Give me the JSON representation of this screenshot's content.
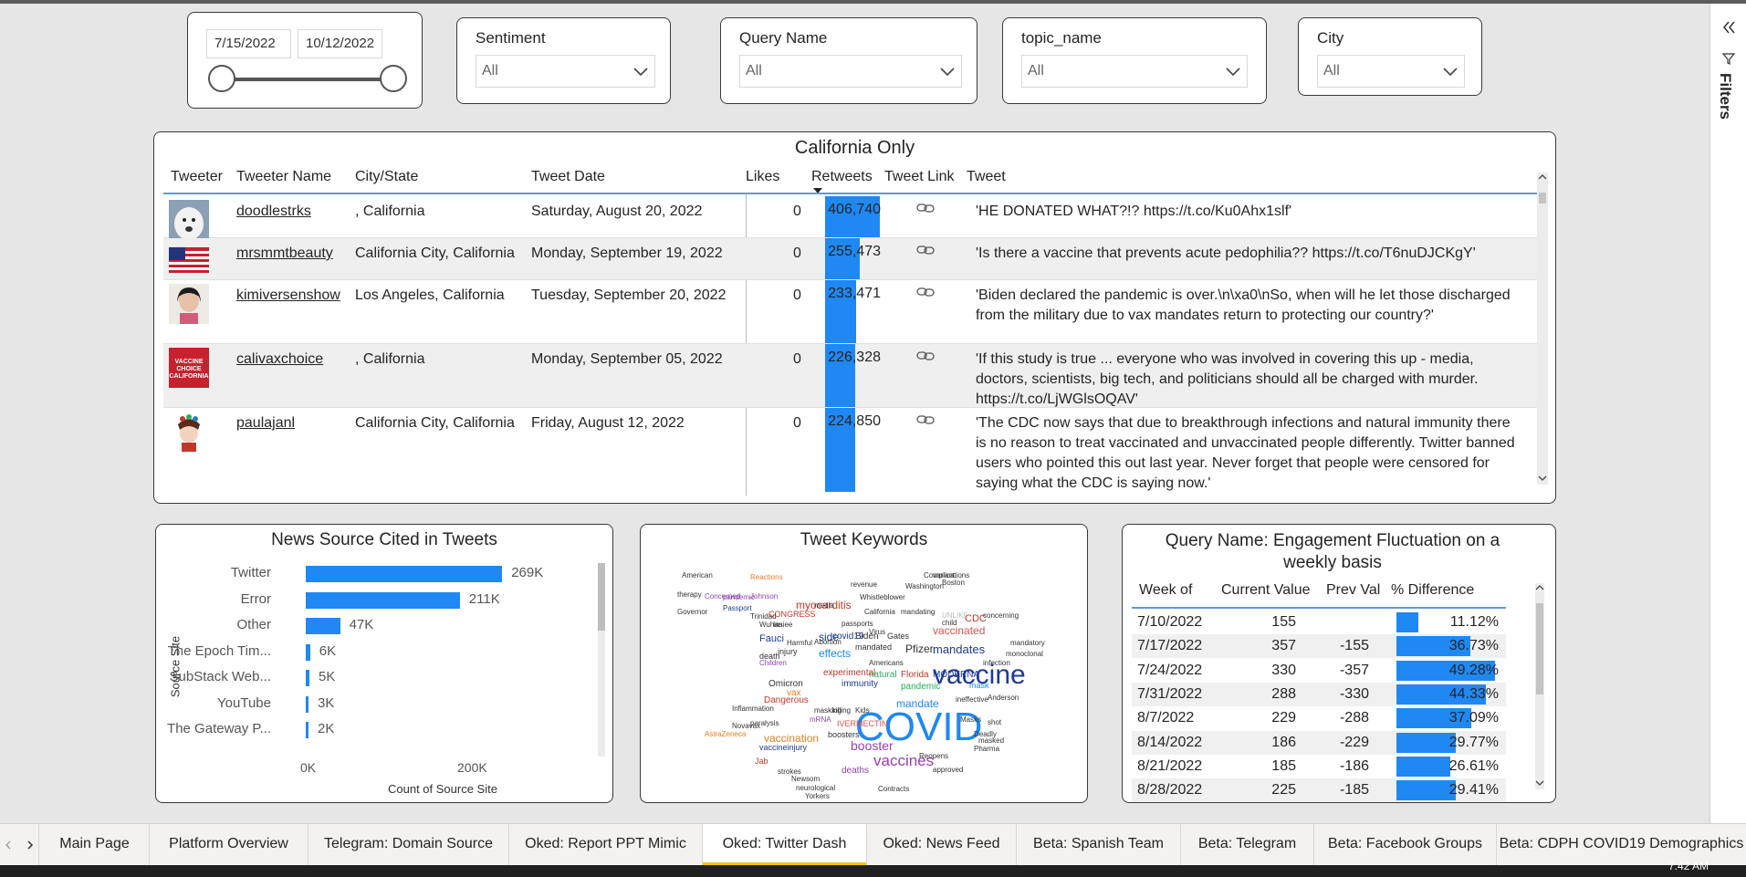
{
  "slicers": {
    "date": {
      "start": "7/15/2022",
      "end": "10/12/2022"
    },
    "dropdowns": [
      {
        "label": "Sentiment",
        "value": "All"
      },
      {
        "label": "Query Name",
        "value": "All"
      },
      {
        "label": "topic_name",
        "value": "All"
      },
      {
        "label": "City",
        "value": "All"
      }
    ]
  },
  "filters_pane": {
    "label": "Filters",
    "icons": [
      "double-chevron-left-icon",
      "funnel-icon"
    ]
  },
  "table": {
    "title": "California Only",
    "headers": [
      "Tweeter",
      "Tweeter Name",
      "City/State",
      "Tweet Date",
      "Likes",
      "Retweets",
      "Tweet Link",
      "Tweet"
    ],
    "rows": [
      {
        "name": "doodlestrks",
        "city": ", California",
        "date": "Saturday, August 20, 2022",
        "likes": "0",
        "retweets": "406,740",
        "retweets_value": 406740,
        "tweet": "'HE DONATED WHAT?!? https://t.co/Ku0Ahx1slf'"
      },
      {
        "name": "mrsmmtbeauty",
        "city": "California City, California",
        "date": "Monday, September 19, 2022",
        "likes": "0",
        "retweets": "255,473",
        "retweets_value": 255473,
        "tweet": "'Is there a vaccine that prevents acute pedophilia?? https://t.co/T6nuDJCKgY'"
      },
      {
        "name": "kimiversenshow",
        "city": "Los Angeles, California",
        "date": "Tuesday, September 20, 2022",
        "likes": "0",
        "retweets": "233,471",
        "retweets_value": 233471,
        "tweet": "'Biden declared the pandemic is over.\\n\\xa0\\nSo, when will he let those discharged from the military due to vax mandates return to protecting our country?'"
      },
      {
        "name": "calivaxchoice",
        "city": ", California",
        "date": "Monday, September 05, 2022",
        "likes": "0",
        "retweets": "226,328",
        "retweets_value": 226328,
        "tweet": "'If this study is true ... everyone who was involved in covering this up - media, doctors, scientists, big tech, and politicians should all be charged with murder. https://t.co/LjWGlsOQAV'"
      },
      {
        "name": "paulajanl",
        "city": "California City, California",
        "date": "Friday, August 12, 2022",
        "likes": "0",
        "retweets": "224,850",
        "retweets_value": 224850,
        "tweet": "'The CDC now says that due to breakthrough infections and natural immunity there is no reason to treat vaccinated and unvaccinated people differently. Twitter banned users who pointed this out last year. Never forget that people were censored for saying what the CDC is saying now.'"
      }
    ],
    "avatar_text": "VACCINE CHOICE CALIFORNIA"
  },
  "news_chart": {
    "title": "News Source Cited in Tweets",
    "ylabel": "Source Site",
    "xlabel": "Count of Source Site",
    "xticks": [
      "0K",
      "200K"
    ]
  },
  "chart_data": {
    "type": "bar",
    "orientation": "horizontal",
    "title": "News Source Cited in Tweets",
    "xlabel": "Count of Source Site",
    "ylabel": "Source Site",
    "categories": [
      "Twitter",
      "Error",
      "Other",
      "The Epoch Tim...",
      "SubStack Web...",
      "YouTube",
      "The Gateway P..."
    ],
    "values": [
      269000,
      211000,
      47000,
      6000,
      5000,
      3000,
      2000
    ],
    "labels": [
      "269K",
      "211K",
      "47K",
      "6K",
      "5K",
      "3K",
      "2K"
    ],
    "xlim": [
      0,
      300000
    ]
  },
  "wordcloud": {
    "title": "Tweet Keywords",
    "words": [
      {
        "text": "COVID",
        "size": 44,
        "color": "#1f88f3"
      },
      {
        "text": "vaccine",
        "size": 30,
        "color": "#1f3a93"
      },
      {
        "text": "vaccines",
        "size": 17,
        "color": "#9b3fb5"
      },
      {
        "text": "booster",
        "size": 14,
        "color": "#9b3fb5"
      },
      {
        "text": "mandates",
        "size": 13,
        "color": "#1f3a93"
      },
      {
        "text": "vaccinated",
        "size": 12,
        "color": "#d9534f"
      },
      {
        "text": "myocarditis",
        "size": 12,
        "color": "#c0392b"
      },
      {
        "text": "Pfizer",
        "size": 12,
        "color": "#333333"
      },
      {
        "text": "mandate",
        "size": 12,
        "color": "#1f88f3"
      },
      {
        "text": "effects",
        "size": 12,
        "color": "#1f88f3"
      },
      {
        "text": "vaccination",
        "size": 12,
        "color": "#e67e22"
      },
      {
        "text": "side",
        "size": 12,
        "color": "#1f3a93"
      },
      {
        "text": "Fauci",
        "size": 11,
        "color": "#1f3a93"
      },
      {
        "text": "CDC",
        "size": 11,
        "color": "#c0392b"
      },
      {
        "text": "MODERNA",
        "size": 10,
        "color": "#1f3a93"
      },
      {
        "text": "pandemic",
        "size": 10,
        "color": "#27ae60"
      },
      {
        "text": "Florida",
        "size": 10,
        "color": "#c0392b"
      },
      {
        "text": "immunity",
        "size": 10,
        "color": "#1f3a93"
      },
      {
        "text": "Omicron",
        "size": 10,
        "color": "#333333"
      },
      {
        "text": "natural",
        "size": 10,
        "color": "#27ae60"
      },
      {
        "text": "deaths",
        "size": 10,
        "color": "#8e44ad"
      },
      {
        "text": "Biden",
        "size": 10,
        "color": "#333333"
      },
      {
        "text": "covid19",
        "size": 10,
        "color": "#1f3a93"
      },
      {
        "text": "experimental",
        "size": 10,
        "color": "#c0392b"
      },
      {
        "text": "vax",
        "size": 10,
        "color": "#e67e22"
      },
      {
        "text": "Dangerous",
        "size": 10,
        "color": "#c0392b"
      },
      {
        "text": "injury",
        "size": 9,
        "color": "#333333"
      },
      {
        "text": "death",
        "size": 9,
        "color": "#333333"
      },
      {
        "text": "Jab",
        "size": 9,
        "color": "#c0392b"
      },
      {
        "text": "vaccineinjury",
        "size": 9,
        "color": "#1f3a93"
      },
      {
        "text": "boosters",
        "size": 9,
        "color": "#333333"
      },
      {
        "text": "IVERMECTIN",
        "size": 9,
        "color": "#d9534f"
      },
      {
        "text": "Gates",
        "size": 9,
        "color": "#333333"
      },
      {
        "text": "mandated",
        "size": 9,
        "color": "#333333"
      },
      {
        "text": "mask",
        "size": 9,
        "color": "#1f88f3"
      },
      {
        "text": "CONGRESS",
        "size": 9,
        "color": "#c0392b"
      },
      {
        "text": "Passport",
        "size": 8,
        "color": "#1f3a93"
      },
      {
        "text": "pandemic",
        "size": 8,
        "color": "#8e44ad"
      },
      {
        "text": "revenue",
        "size": 8,
        "color": "#333333"
      },
      {
        "text": "Whistleblower",
        "size": 8,
        "color": "#333333"
      },
      {
        "text": "Washington",
        "size": 8,
        "color": "#333333"
      },
      {
        "text": "Complications",
        "size": 8,
        "color": "#333333"
      },
      {
        "text": "Reactions",
        "size": 8,
        "color": "#e67e22"
      },
      {
        "text": "American",
        "size": 8,
        "color": "#333333"
      },
      {
        "text": "therapy",
        "size": 8,
        "color": "#333333"
      },
      {
        "text": "Concerned",
        "size": 8,
        "color": "#8e44ad"
      },
      {
        "text": "Johnson",
        "size": 8,
        "color": "#8e44ad"
      },
      {
        "text": "media",
        "size": 8,
        "color": "#333333"
      },
      {
        "text": "Trinidad",
        "size": 8,
        "color": "#333333"
      },
      {
        "text": "Wuhan",
        "size": 8,
        "color": "#333333"
      },
      {
        "text": "Insiee",
        "size": 8,
        "color": "#333333"
      },
      {
        "text": "California",
        "size": 8,
        "color": "#333333"
      },
      {
        "text": "mandating",
        "size": 8,
        "color": "#333333"
      },
      {
        "text": "UNLIKE",
        "size": 8,
        "color": "#bbbbbb"
      },
      {
        "text": "concerning",
        "size": 8,
        "color": "#333333"
      },
      {
        "text": "Governor",
        "size": 8,
        "color": "#333333"
      },
      {
        "text": "Abortion",
        "size": 8,
        "color": "#333333"
      },
      {
        "text": "Virus",
        "size": 8,
        "color": "#333333"
      },
      {
        "text": "passports",
        "size": 8,
        "color": "#333333"
      },
      {
        "text": "Harmful",
        "size": 8,
        "color": "#333333"
      },
      {
        "text": "Children",
        "size": 8,
        "color": "#8e44ad"
      },
      {
        "text": "masking",
        "size": 8,
        "color": "#333333"
      },
      {
        "text": "killing",
        "size": 8,
        "color": "#333333"
      },
      {
        "text": "Americans",
        "size": 8,
        "color": "#333333"
      },
      {
        "text": "ineffective",
        "size": 8,
        "color": "#333333"
      },
      {
        "text": "infection",
        "size": 8,
        "color": "#333333"
      },
      {
        "text": "Anderson",
        "size": 8,
        "color": "#333333"
      },
      {
        "text": "Inflammation",
        "size": 8,
        "color": "#333333"
      },
      {
        "text": "mRNA",
        "size": 8,
        "color": "#8e44ad"
      },
      {
        "text": "Masks",
        "size": 8,
        "color": "#333333"
      },
      {
        "text": "Deadly",
        "size": 8,
        "color": "#333333"
      },
      {
        "text": "paralysis",
        "size": 8,
        "color": "#333333"
      },
      {
        "text": "Novavax",
        "size": 8,
        "color": "#333333"
      },
      {
        "text": "AstraZeneca",
        "size": 8,
        "color": "#e67e22"
      },
      {
        "text": "strokes",
        "size": 8,
        "color": "#333333"
      },
      {
        "text": "Newsom",
        "size": 8,
        "color": "#333333"
      },
      {
        "text": "neurological",
        "size": 8,
        "color": "#333333"
      },
      {
        "text": "Yorkers",
        "size": 8,
        "color": "#333333"
      },
      {
        "text": "Contracts",
        "size": 8,
        "color": "#333333"
      },
      {
        "text": "approved",
        "size": 8,
        "color": "#333333"
      },
      {
        "text": "Reopens",
        "size": 8,
        "color": "#333333"
      },
      {
        "text": "Pharma",
        "size": 8,
        "color": "#333333"
      },
      {
        "text": "masked",
        "size": 8,
        "color": "#333333"
      },
      {
        "text": "shot",
        "size": 8,
        "color": "#333333"
      },
      {
        "text": "child",
        "size": 8,
        "color": "#333333"
      },
      {
        "text": "mandatory",
        "size": 8,
        "color": "#333333"
      },
      {
        "text": "monoclonal",
        "size": 8,
        "color": "#333333"
      },
      {
        "text": "variant",
        "size": 8,
        "color": "#333333"
      },
      {
        "text": "Boston",
        "size": 8,
        "color": "#333333"
      },
      {
        "text": "Kids",
        "size": 8,
        "color": "#333333"
      }
    ]
  },
  "engagement": {
    "title": "Query Name: Engagement Fluctuation on a weekly basis",
    "headers": [
      "Week of",
      "Current Value",
      "Prev Val",
      "% Difference"
    ],
    "rows": [
      {
        "week": "7/10/2022",
        "cur": "155",
        "prev": "",
        "pct": "11.12%",
        "pct_value": 11.12
      },
      {
        "week": "7/17/2022",
        "cur": "357",
        "prev": "-155",
        "pct": "36.73%",
        "pct_value": 36.73
      },
      {
        "week": "7/24/2022",
        "cur": "330",
        "prev": "-357",
        "pct": "49.28%",
        "pct_value": 49.28
      },
      {
        "week": "7/31/2022",
        "cur": "288",
        "prev": "-330",
        "pct": "44.33%",
        "pct_value": 44.33
      },
      {
        "week": "8/7/2022",
        "cur": "229",
        "prev": "-288",
        "pct": "37.09%",
        "pct_value": 37.09
      },
      {
        "week": "8/14/2022",
        "cur": "186",
        "prev": "-229",
        "pct": "29.77%",
        "pct_value": 29.77
      },
      {
        "week": "8/21/2022",
        "cur": "185",
        "prev": "-186",
        "pct": "26.61%",
        "pct_value": 26.61
      },
      {
        "week": "8/28/2022",
        "cur": "225",
        "prev": "-185",
        "pct": "29.41%",
        "pct_value": 29.41
      }
    ]
  },
  "tabs": [
    {
      "label": "Main Page"
    },
    {
      "label": "Platform Overview"
    },
    {
      "label": "Telegram: Domain Source"
    },
    {
      "label": "Oked: Report PPT Mimic"
    },
    {
      "label": "Oked: Twitter Dash",
      "active": true
    },
    {
      "label": "Oked: News Feed"
    },
    {
      "label": "Beta: Spanish Team"
    },
    {
      "label": "Beta: Telegram"
    },
    {
      "label": "Beta: Facebook Groups"
    },
    {
      "label": "Beta: CDPH COVID19 Demographics"
    }
  ],
  "taskbar": {
    "clock": "7:42 AM"
  },
  "colors": {
    "accent": "#1f88f3",
    "active_tab": "#f2c811",
    "header_line": "#5b9bd5"
  }
}
